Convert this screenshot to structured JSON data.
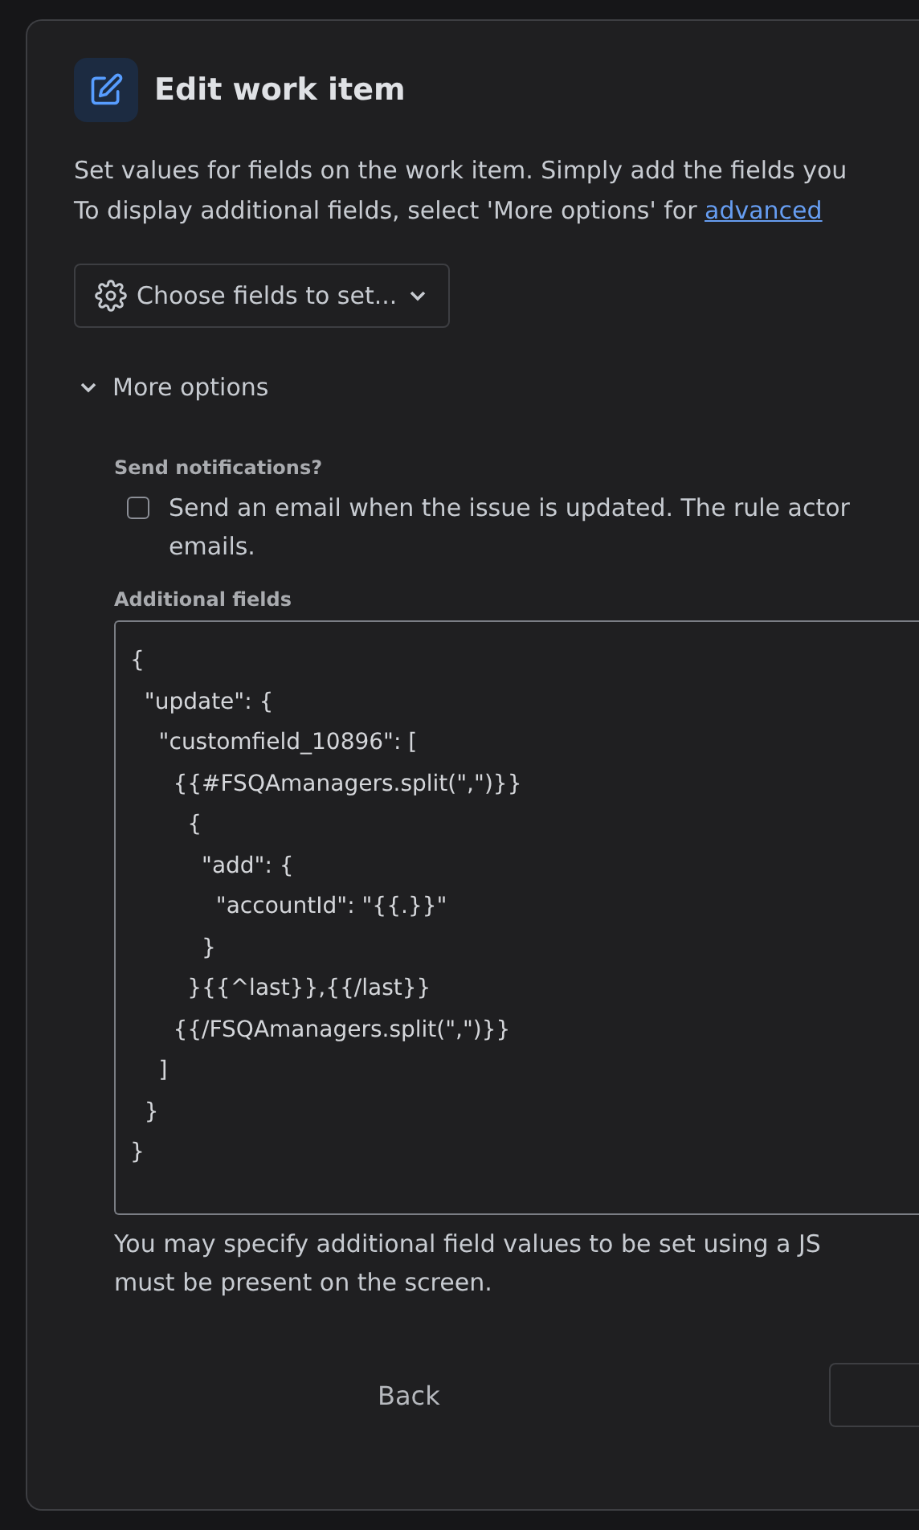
{
  "header": {
    "title": "Edit work item"
  },
  "description": {
    "lines": [
      "Set values for fields on the work item. Simply add the fields you",
      "To display additional fields, select 'More options' for "
    ],
    "link": "advanced"
  },
  "field_picker": {
    "label": "Choose fields to set..."
  },
  "more_options": {
    "label": "More options",
    "expanded": true
  },
  "notifications": {
    "label": "Send notifications?",
    "checked": false,
    "text_lines": [
      "Send an email when the issue is updated. The rule actor",
      "emails."
    ]
  },
  "additional_fields": {
    "label": "Additional fields",
    "value": "{\n  \"update\": {\n    \"customfield_10896\": [\n      {{#FSQAmanagers.split(\",\")}}\n        {\n          \"add\": {\n            \"accountId\": \"{{.}}\"\n          }\n        }{{^last}},{{/last}}\n      {{/FSQAmanagers.split(\",\")}}\n    ]\n  }\n}",
    "help_lines": [
      "You may specify additional field values to be set using a JS",
      "must be present on the screen."
    ]
  },
  "footer": {
    "back": "Back"
  }
}
